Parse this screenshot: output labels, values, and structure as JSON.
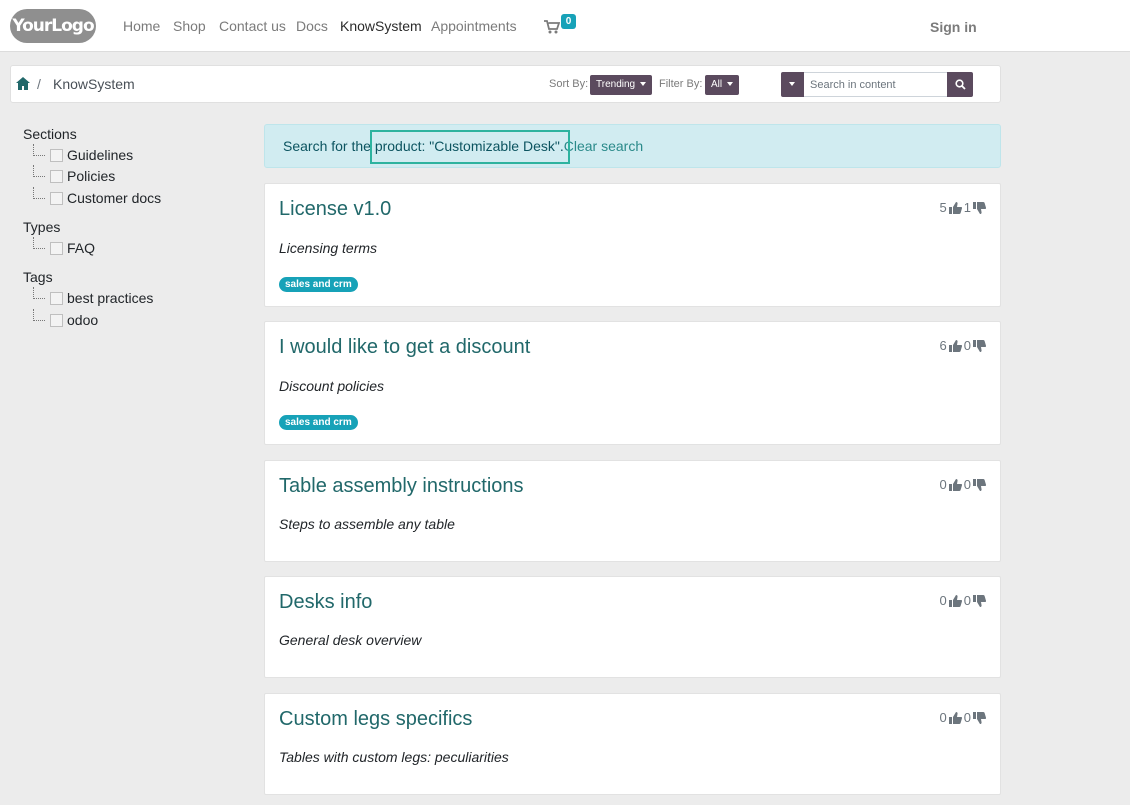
{
  "navbar": {
    "logo_text": "YourLogo",
    "links": [
      "Home",
      "Shop",
      "Contact us",
      "Docs",
      "KnowSystem",
      "Appointments"
    ],
    "active_link": "KnowSystem",
    "cart_count": "0",
    "sign_in": "Sign in"
  },
  "breadcrumb": {
    "separator": "/",
    "current": "KnowSystem"
  },
  "controls": {
    "sort_label": "Sort By:",
    "sort_value": "Trending",
    "filter_label": "Filter By:",
    "filter_value": "All",
    "search_placeholder": "Search in content"
  },
  "sidebar": {
    "sections_title": "Sections",
    "sections": [
      "Guidelines",
      "Policies",
      "Customer docs"
    ],
    "types_title": "Types",
    "types": [
      "FAQ"
    ],
    "tags_title": "Tags",
    "tags": [
      "best practices",
      "odoo"
    ]
  },
  "alert": {
    "prefix": "Search for the product: \"Customizable Desk\".",
    "clear_link": "Clear search"
  },
  "articles": [
    {
      "title": "License v1.0",
      "summary": "Licensing terms",
      "tag": "sales and crm",
      "likes": "5",
      "dislikes": "1"
    },
    {
      "title": "I would like to get a discount",
      "summary": "Discount policies",
      "tag": "sales and crm",
      "likes": "6",
      "dislikes": "0"
    },
    {
      "title": "Table assembly instructions",
      "summary": "Steps to assemble any table",
      "tag": "",
      "likes": "0",
      "dislikes": "0"
    },
    {
      "title": "Desks info",
      "summary": "General desk overview",
      "tag": "",
      "likes": "0",
      "dislikes": "0"
    },
    {
      "title": "Custom legs specifics",
      "summary": "Tables with custom legs: peculiarities",
      "tag": "",
      "likes": "0",
      "dislikes": "0"
    }
  ],
  "colors": {
    "accent": "#5b4a5e",
    "title": "#21686a",
    "badge": "#17a2b8",
    "alert_bg": "#d1ecf1",
    "highlight": "#2db39f"
  }
}
